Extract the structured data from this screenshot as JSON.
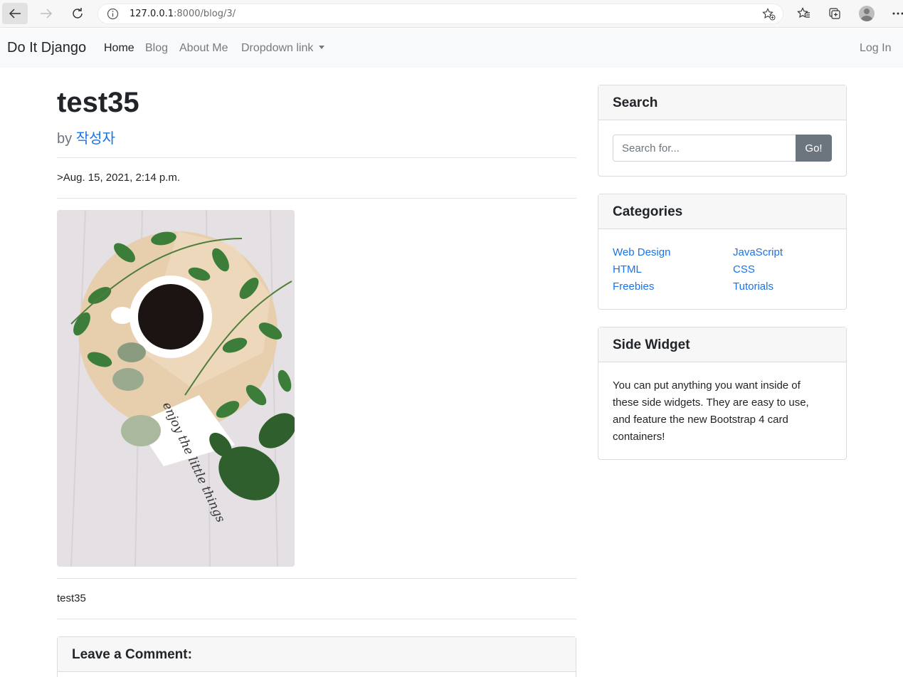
{
  "browser": {
    "url_host": "127.0.0.1",
    "url_rest": ":8000/blog/3/"
  },
  "navbar": {
    "brand": "Do It Django",
    "links": [
      "Home",
      "Blog",
      "About Me",
      "Dropdown link"
    ],
    "login": "Log In"
  },
  "post": {
    "title": "test35",
    "by_prefix": "by",
    "author": "작성자",
    "date": ">Aug. 15, 2021, 2:14 p.m.",
    "image_text": "enjoy the little things",
    "content": "test35"
  },
  "comment": {
    "header": "Leave a Comment:"
  },
  "sidebar": {
    "search": {
      "header": "Search",
      "placeholder": "Search for...",
      "button": "Go!"
    },
    "categories": {
      "header": "Categories",
      "left": [
        "Web Design",
        "HTML",
        "Freebies"
      ],
      "right": [
        "JavaScript",
        "CSS",
        "Tutorials"
      ]
    },
    "widget": {
      "header": "Side Widget",
      "body": "You can put anything you want inside of these side widgets. They are easy to use, and feature the new Bootstrap 4 card containers!"
    }
  }
}
